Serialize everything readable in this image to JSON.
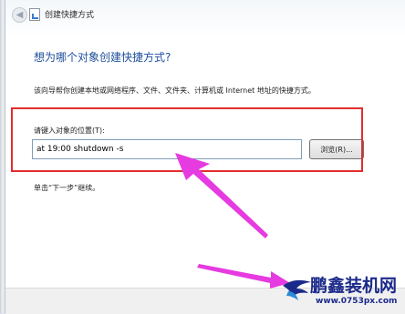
{
  "window": {
    "title": "创建快捷方式"
  },
  "wizard": {
    "heading": "想为哪个对象创建快捷方式?",
    "intro": "该向导帮你创建本地或网络程序、文件、文件夹、计算机或 Internet 地址的快捷方式。",
    "location_label": "请键入对象的位置(T):",
    "location_value": "at 19:00 shutdown -s",
    "browse_label": "浏览(R)...",
    "hint": "单击“下一步”继续。"
  },
  "annotations": {
    "highlight_color": "#e32d2d",
    "arrow_color": "#e63be0"
  },
  "watermark": {
    "name": "鹏鑫装机网",
    "url": "www.0753px.com",
    "color": "#1b2a8a"
  }
}
